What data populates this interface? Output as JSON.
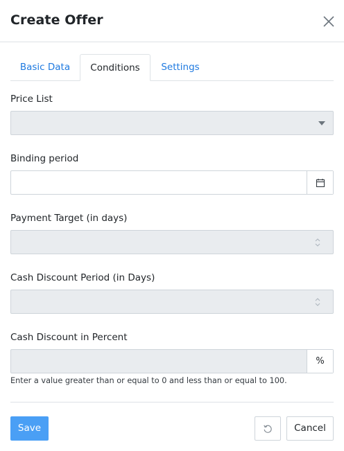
{
  "dialog": {
    "title": "Create Offer",
    "close_icon": "close-icon"
  },
  "tabs": [
    {
      "label": "Basic Data",
      "active": false
    },
    {
      "label": "Conditions",
      "active": true
    },
    {
      "label": "Settings",
      "active": false
    }
  ],
  "form": {
    "price_list": {
      "label": "Price List",
      "value": ""
    },
    "binding_period": {
      "label": "Binding period",
      "value": "",
      "icon": "calendar-icon"
    },
    "payment_target": {
      "label": "Payment Target (in days)",
      "value": ""
    },
    "cash_discount_period": {
      "label": "Cash Discount Period (in Days)",
      "value": ""
    },
    "cash_discount_percent": {
      "label": "Cash Discount in Percent",
      "value": "",
      "unit": "%"
    },
    "help_text": "Enter a value greater than or equal to 0 and less than or equal to 100."
  },
  "footer": {
    "save_label": "Save",
    "reset_icon": "undo-icon",
    "cancel_label": "Cancel"
  },
  "colors": {
    "primary": "#4a9ff5",
    "link": "#1f7ae0",
    "disabled_bg": "#e9ecef",
    "border": "#ced4da"
  }
}
